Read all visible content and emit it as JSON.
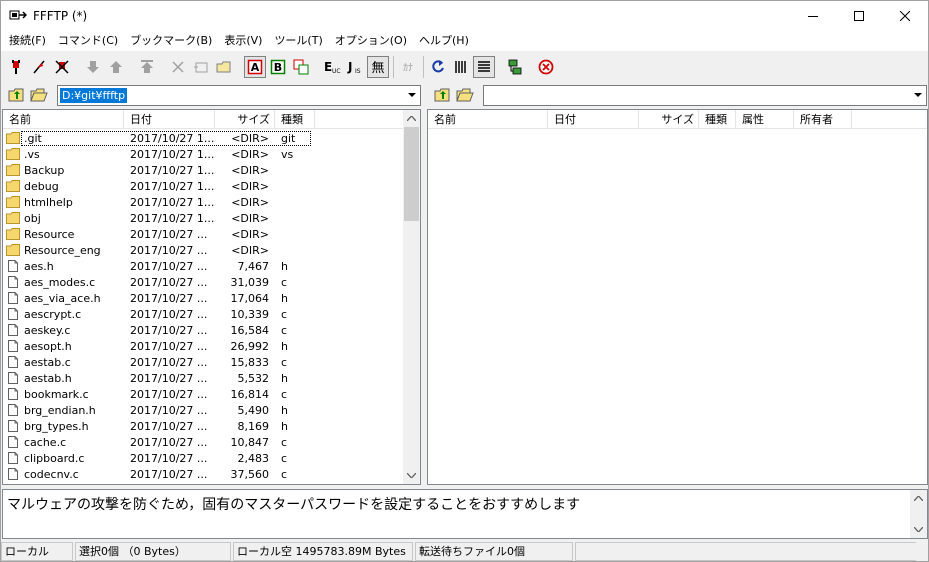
{
  "window": {
    "title": "FFFTP (*)"
  },
  "menu": [
    "接続(F)",
    "コマンド(C)",
    "ブックマーク(B)",
    "表示(V)",
    "ツール(T)",
    "オプション(O)",
    "ヘルプ(H)"
  ],
  "toolbar": {
    "icons": [
      "connect-icon",
      "quick-connect-icon",
      "disconnect-icon",
      "download-icon",
      "upload-icon",
      "mirror-upload-icon",
      "delete-icon",
      "rename-icon",
      "mkdir-icon",
      "ascii-mode-icon",
      "binary-mode-icon",
      "auto-mode-icon",
      "euc-icon",
      "jis-icon",
      "no-convert-icon",
      "kana-icon",
      "refresh-icon",
      "list-view-icon",
      "detail-view-icon",
      "sync-folder-icon",
      "stop-icon"
    ],
    "labels": {
      "a": "A",
      "b": "B",
      "exe": "E",
      "exe_sub": "UC",
      "jis": "J",
      "jis_sub": "IS",
      "mu": "無",
      "kana": "ｶﾅ"
    }
  },
  "local": {
    "path": "D:¥git¥ffftp",
    "columns": [
      "名前",
      "日付",
      "サイズ",
      "種類"
    ],
    "files": [
      {
        "name": ".git",
        "date": "2017/10/27 1...",
        "size": "<DIR>",
        "kind": "git",
        "type": "folder"
      },
      {
        "name": ".vs",
        "date": "2017/10/27 1...",
        "size": "<DIR>",
        "kind": "vs",
        "type": "folder"
      },
      {
        "name": "Backup",
        "date": "2017/10/27 1...",
        "size": "<DIR>",
        "kind": "",
        "type": "folder"
      },
      {
        "name": "debug",
        "date": "2017/10/27 1...",
        "size": "<DIR>",
        "kind": "",
        "type": "folder"
      },
      {
        "name": "htmlhelp",
        "date": "2017/10/27 1...",
        "size": "<DIR>",
        "kind": "",
        "type": "folder"
      },
      {
        "name": "obj",
        "date": "2017/10/27 1...",
        "size": "<DIR>",
        "kind": "",
        "type": "folder"
      },
      {
        "name": "Resource",
        "date": "2017/10/27 ...",
        "size": "<DIR>",
        "kind": "",
        "type": "folder"
      },
      {
        "name": "Resource_eng",
        "date": "2017/10/27 ...",
        "size": "<DIR>",
        "kind": "",
        "type": "folder"
      },
      {
        "name": "aes.h",
        "date": "2017/10/27 ...",
        "size": "7,467",
        "kind": "h",
        "type": "file"
      },
      {
        "name": "aes_modes.c",
        "date": "2017/10/27 ...",
        "size": "31,039",
        "kind": "c",
        "type": "file"
      },
      {
        "name": "aes_via_ace.h",
        "date": "2017/10/27 ...",
        "size": "17,064",
        "kind": "h",
        "type": "file"
      },
      {
        "name": "aescrypt.c",
        "date": "2017/10/27 ...",
        "size": "10,339",
        "kind": "c",
        "type": "file"
      },
      {
        "name": "aeskey.c",
        "date": "2017/10/27 ...",
        "size": "16,584",
        "kind": "c",
        "type": "file"
      },
      {
        "name": "aesopt.h",
        "date": "2017/10/27 ...",
        "size": "26,992",
        "kind": "h",
        "type": "file"
      },
      {
        "name": "aestab.c",
        "date": "2017/10/27 ...",
        "size": "15,833",
        "kind": "c",
        "type": "file"
      },
      {
        "name": "aestab.h",
        "date": "2017/10/27 ...",
        "size": "5,532",
        "kind": "h",
        "type": "file"
      },
      {
        "name": "bookmark.c",
        "date": "2017/10/27 ...",
        "size": "16,814",
        "kind": "c",
        "type": "file"
      },
      {
        "name": "brg_endian.h",
        "date": "2017/10/27 ...",
        "size": "5,490",
        "kind": "h",
        "type": "file"
      },
      {
        "name": "brg_types.h",
        "date": "2017/10/27 ...",
        "size": "8,169",
        "kind": "h",
        "type": "file"
      },
      {
        "name": "cache.c",
        "date": "2017/10/27 ...",
        "size": "10,847",
        "kind": "c",
        "type": "file"
      },
      {
        "name": "clipboard.c",
        "date": "2017/10/27 ...",
        "size": "2,483",
        "kind": "c",
        "type": "file"
      },
      {
        "name": "codecnv.c",
        "date": "2017/10/27 ...",
        "size": "37,560",
        "kind": "c",
        "type": "file"
      }
    ]
  },
  "remote": {
    "path": "",
    "columns": [
      "名前",
      "日付",
      "サイズ",
      "種類",
      "属性",
      "所有者"
    ]
  },
  "log": {
    "message": "マルウェアの攻撃を防ぐため，固有のマスターパスワードを設定することをおすすめします"
  },
  "status": {
    "mode": "ローカル",
    "selection": "選択0個 （0 Bytes）",
    "free": "ローカル空 1495783.89M Bytes",
    "queue": "転送待ちファイル0個"
  }
}
